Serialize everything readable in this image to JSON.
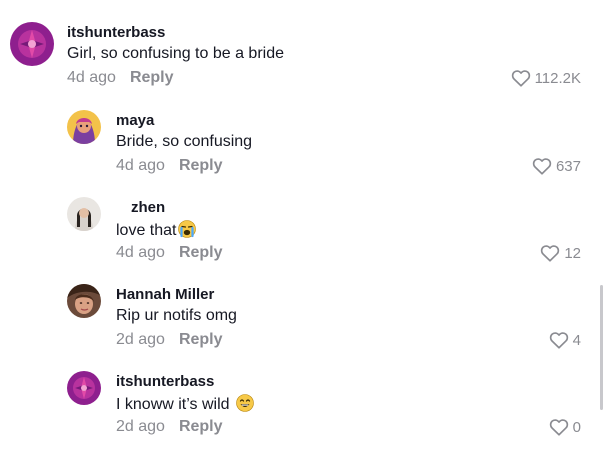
{
  "comments": [
    {
      "username": "itshunterbass",
      "text": "Girl, so confusing to be a bride",
      "time": "4d ago",
      "reply": "Reply",
      "likes": "112.2K",
      "avatar": "itshunterbass-avatar",
      "emoji": ""
    },
    {
      "username": "maya",
      "text": "Bride, so confusing",
      "time": "4d ago",
      "reply": "Reply",
      "likes": "637",
      "avatar": "maya-avatar",
      "emoji": ""
    },
    {
      "username": " zhen",
      "text": "love that",
      "time": "4d ago",
      "reply": "Reply",
      "likes": "12",
      "avatar": "zhen-avatar",
      "emoji": "crying-face-emoji"
    },
    {
      "username": "Hannah Miller",
      "text": "Rip ur notifs omg",
      "time": "2d ago",
      "reply": "Reply",
      "likes": "4",
      "avatar": "hannah-avatar",
      "emoji": ""
    },
    {
      "username": "itshunterbass",
      "text": "I knoww it’s wild",
      "time": "2d ago",
      "reply": "Reply",
      "likes": "0",
      "avatar": "itshunterbass-avatar",
      "emoji": "laughing-emoji"
    }
  ],
  "colors": {
    "text": "#161823",
    "muted": "#8a8b91",
    "brand_purple": "#8e1f8e"
  }
}
